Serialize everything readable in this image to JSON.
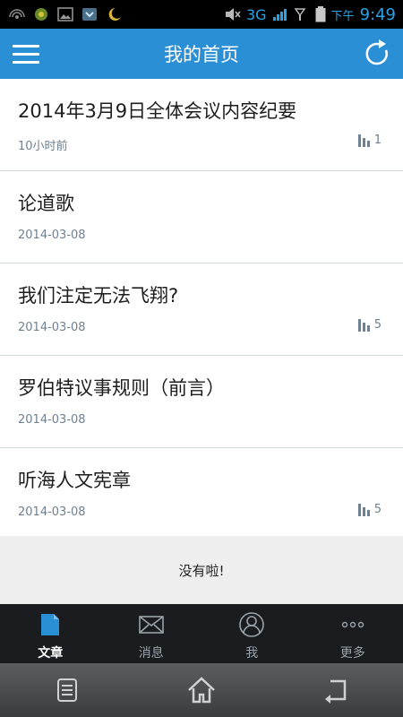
{
  "status_bar": {
    "network": "3G",
    "ampm": "下午",
    "time": "9:49",
    "icons": [
      "wifi-hotspot-icon",
      "app-notification-icon",
      "image-icon",
      "download-icon",
      "moon-icon",
      "mute-icon",
      "signal-icon",
      "battery-icon"
    ]
  },
  "header": {
    "title": "我的首页"
  },
  "articles": [
    {
      "title": "2014年3月9日全体会议内容纪要",
      "date": "10小时前",
      "count": "1"
    },
    {
      "title": "论道歌",
      "date": "2014-03-08",
      "count": null
    },
    {
      "title": "我们注定无法飞翔?",
      "date": "2014-03-08",
      "count": "5"
    },
    {
      "title": "罗伯特议事规则（前言）",
      "date": "2014-03-08",
      "count": null
    },
    {
      "title": "听海人文宪章",
      "date": "2014-03-08",
      "count": "5"
    }
  ],
  "footer_message": "没有啦!",
  "tabs": [
    {
      "label": "文章",
      "active": true
    },
    {
      "label": "消息",
      "active": false
    },
    {
      "label": "我",
      "active": false
    },
    {
      "label": "更多",
      "active": false
    }
  ],
  "colors": {
    "header_bg": "#2b8fd6",
    "tab_active": "#2b8fd6",
    "meta_text": "#6f8090"
  }
}
